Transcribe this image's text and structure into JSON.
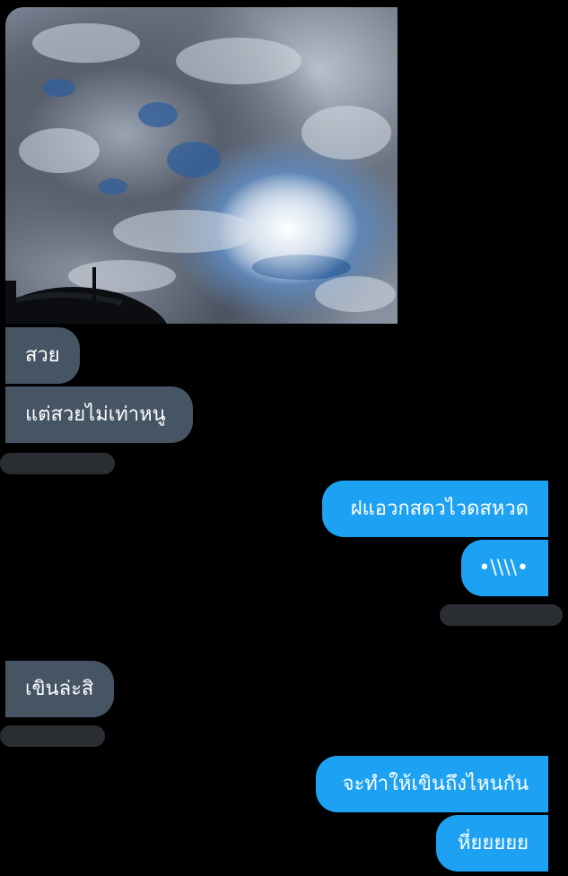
{
  "conversation": {
    "photo": {
      "kind": "sky-with-clouds-photo"
    },
    "messages": [
      {
        "side": "incoming",
        "text": "สวย"
      },
      {
        "side": "incoming",
        "text": "แต่สวยไม่เท่าหนู"
      },
      {
        "side": "outgoing",
        "text": "ฝแอวกสดวไวดสหวด"
      },
      {
        "side": "outgoing",
        "text": "•\\\\\\\\•"
      },
      {
        "side": "incoming",
        "text": "เขินล่ะสิ"
      },
      {
        "side": "outgoing",
        "text": "จะทำให้เขินถึงไหนกัน"
      },
      {
        "side": "outgoing",
        "text": "หี่ยยยยย"
      }
    ]
  },
  "colors": {
    "background": "#000000",
    "incoming_bubble": "#465564",
    "outgoing_bubble": "#1da1f2",
    "timestamp_placeholder": "#2a2e33",
    "text": "#ffffff"
  }
}
